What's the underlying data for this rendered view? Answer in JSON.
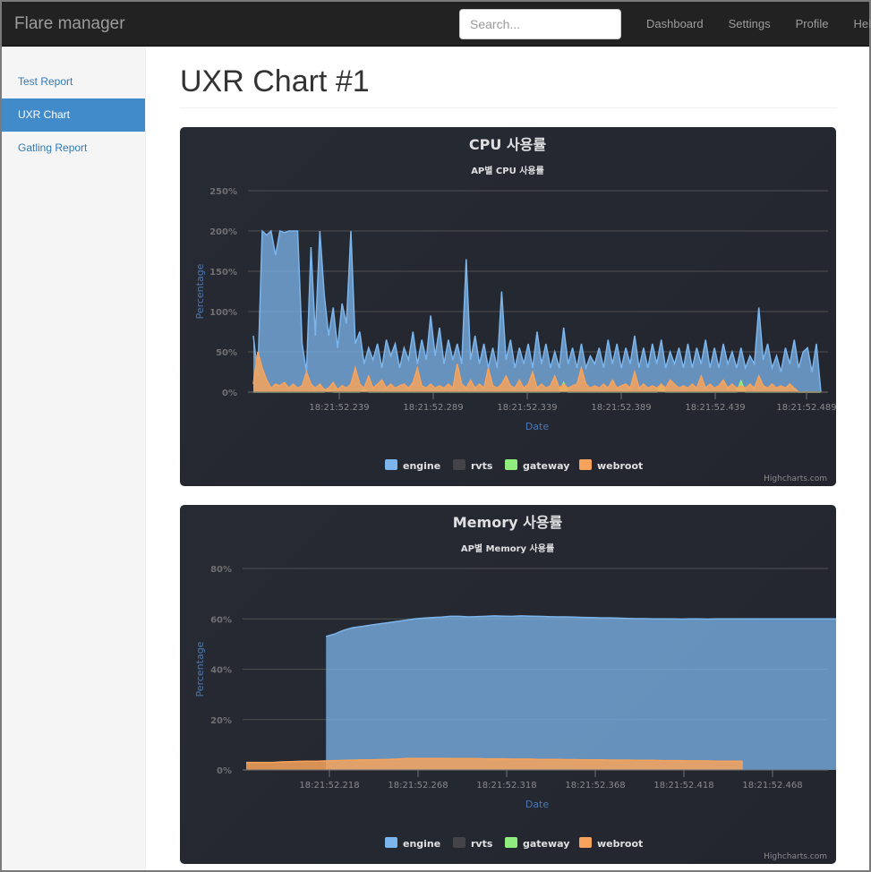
{
  "app": {
    "brand": "Flare manager",
    "search": {
      "placeholder": "Search..."
    },
    "nav": [
      "Dashboard",
      "Settings",
      "Profile",
      "Help"
    ]
  },
  "sidebar": {
    "items": [
      {
        "label": "Test Report",
        "active": false
      },
      {
        "label": "UXR Chart",
        "active": true
      },
      {
        "label": "Gatling Report",
        "active": false
      }
    ]
  },
  "page": {
    "title": "UXR Chart #1"
  },
  "colors": {
    "engine": "#7cb5ec",
    "rvts": "#434348",
    "gateway": "#90ed7d",
    "webroot": "#f7a35c",
    "card_bg": "#24272f",
    "grid": "#505053",
    "active_nav": "#428bca"
  },
  "chart_data": [
    {
      "type": "area",
      "title": "CPU 사용률",
      "subtitle": "AP별 CPU 사용률",
      "xlabel": "Date",
      "ylabel": "Percentage",
      "ylim": [
        0,
        250
      ],
      "yticks": [
        "0%",
        "50%",
        "100%",
        "150%",
        "200%",
        "250%"
      ],
      "xticks": [
        "18:21:52.239",
        "18:21:52.289",
        "18:21:52.339",
        "18:21:52.389",
        "18:21:52.439",
        "18:21:52.489"
      ],
      "grid": true,
      "legend_position": "bottom",
      "legend": [
        "engine",
        "rvts",
        "gateway",
        "webroot"
      ],
      "credits": "Highcharts.com",
      "series": [
        {
          "name": "engine",
          "values": [
            70,
            20,
            200,
            195,
            200,
            170,
            200,
            198,
            200,
            200,
            200,
            60,
            25,
            180,
            70,
            200,
            120,
            70,
            105,
            55,
            110,
            85,
            200,
            60,
            75,
            35,
            55,
            40,
            60,
            30,
            65,
            45,
            60,
            30,
            55,
            40,
            75,
            35,
            65,
            40,
            95,
            45,
            80,
            35,
            65,
            40,
            60,
            35,
            165,
            40,
            70,
            35,
            60,
            30,
            55,
            30,
            125,
            40,
            65,
            30,
            55,
            35,
            60,
            30,
            75,
            35,
            60,
            30,
            50,
            30,
            80,
            35,
            55,
            30,
            60,
            30,
            45,
            35,
            55,
            30,
            65,
            35,
            60,
            30,
            55,
            35,
            70,
            30,
            55,
            30,
            60,
            35,
            65,
            30,
            50,
            35,
            55,
            30,
            60,
            30,
            55,
            35,
            65,
            30,
            55,
            30,
            60,
            35,
            50,
            30,
            55,
            30,
            45,
            35,
            105,
            40,
            60,
            30,
            45,
            25,
            55,
            35,
            65,
            30,
            50,
            55,
            25,
            60,
            0
          ]
        },
        {
          "name": "rvts",
          "values": [
            0,
            0,
            0,
            0,
            0,
            0,
            0,
            0,
            0,
            0,
            0,
            0,
            0,
            0,
            0,
            0,
            0,
            0,
            0,
            0,
            0,
            0,
            0,
            0,
            0,
            0,
            0,
            0,
            0,
            0,
            0,
            0,
            0,
            0,
            0,
            0,
            0,
            0,
            0,
            0,
            0,
            0,
            0,
            0,
            0,
            0,
            0,
            0,
            0,
            0,
            0,
            0,
            0,
            0,
            0,
            0,
            0,
            0,
            0,
            0,
            0,
            0,
            0,
            0,
            0,
            0,
            0,
            0,
            0,
            0,
            0,
            0,
            0,
            0,
            0,
            0,
            0,
            0,
            0,
            0,
            0,
            0,
            0,
            0,
            0,
            0,
            0,
            0,
            0,
            0,
            0,
            0,
            0,
            0,
            0,
            0,
            0,
            0,
            0,
            0,
            0,
            0,
            0,
            0,
            0,
            0,
            0,
            0,
            0,
            0,
            0,
            0,
            0,
            0,
            0,
            0,
            0,
            0,
            0,
            0,
            0,
            0,
            0,
            0,
            0,
            0,
            0,
            0,
            0
          ]
        },
        {
          "name": "gateway",
          "values": [
            0,
            0,
            0,
            0,
            0,
            0,
            0,
            0,
            0,
            0,
            0,
            0,
            0,
            0,
            0,
            0,
            0,
            2,
            0,
            0,
            0,
            0,
            0,
            0,
            0,
            3,
            0,
            0,
            0,
            0,
            0,
            0,
            0,
            0,
            0,
            0,
            0,
            0,
            0,
            0,
            0,
            0,
            0,
            0,
            0,
            0,
            0,
            0,
            0,
            0,
            0,
            0,
            0,
            0,
            0,
            0,
            0,
            0,
            0,
            0,
            0,
            0,
            0,
            0,
            0,
            0,
            0,
            0,
            0,
            0,
            12,
            0,
            0,
            0,
            0,
            0,
            0,
            0,
            0,
            0,
            0,
            0,
            0,
            0,
            0,
            0,
            0,
            0,
            0,
            0,
            0,
            0,
            10,
            0,
            0,
            0,
            0,
            0,
            0,
            0,
            0,
            0,
            0,
            0,
            0,
            0,
            0,
            0,
            0,
            0,
            14,
            0,
            0,
            0,
            0,
            0,
            0,
            0,
            0,
            0,
            0,
            0,
            0,
            0,
            0,
            0,
            0,
            0,
            0
          ]
        },
        {
          "name": "webroot",
          "values": [
            10,
            50,
            30,
            15,
            5,
            10,
            8,
            12,
            5,
            10,
            5,
            8,
            25,
            10,
            5,
            10,
            3,
            5,
            12,
            3,
            8,
            5,
            10,
            30,
            10,
            5,
            20,
            5,
            10,
            15,
            5,
            10,
            5,
            8,
            10,
            5,
            12,
            30,
            8,
            5,
            10,
            5,
            8,
            5,
            10,
            5,
            35,
            10,
            5,
            15,
            5,
            10,
            5,
            30,
            8,
            5,
            10,
            20,
            8,
            5,
            15,
            5,
            10,
            25,
            5,
            10,
            5,
            8,
            20,
            5,
            10,
            5,
            8,
            10,
            30,
            10,
            5,
            8,
            5,
            10,
            5,
            15,
            5,
            8,
            10,
            5,
            25,
            5,
            10,
            5,
            8,
            5,
            10,
            5,
            15,
            10,
            5,
            8,
            5,
            10,
            5,
            20,
            5,
            10,
            5,
            8,
            15,
            5,
            10,
            5,
            8,
            5,
            10,
            5,
            20,
            8,
            5,
            10,
            5,
            8,
            5,
            10,
            5,
            0,
            0,
            0,
            0,
            0,
            0
          ]
        }
      ]
    },
    {
      "type": "area",
      "title": "Memory 사용률",
      "subtitle": "AP별 Memory 사용률",
      "xlabel": "Date",
      "ylabel": "Percentage",
      "ylim": [
        0,
        80
      ],
      "yticks": [
        "0%",
        "20%",
        "40%",
        "60%",
        "80%"
      ],
      "xticks": [
        "18:21:52.218",
        "18:21:52.268",
        "18:21:52.318",
        "18:21:52.368",
        "18:21:52.418",
        "18:21:52.468"
      ],
      "grid": true,
      "legend_position": "bottom",
      "legend": [
        "engine",
        "rvts",
        "gateway",
        "webroot"
      ],
      "credits": "Highcharts.com",
      "series": [
        {
          "name": "engine",
          "start_index": 9,
          "values": [
            53,
            54,
            55.5,
            56.5,
            57,
            57.5,
            58,
            58.5,
            59,
            59.5,
            60,
            60.3,
            60.5,
            60.7,
            61,
            61,
            60.8,
            60.9,
            61,
            61.2,
            61.1,
            61,
            61.2,
            61.1,
            61,
            60.9,
            60.8,
            60.8,
            60.7,
            60.6,
            60.5,
            60.4,
            60.4,
            60.3,
            60.2,
            60.1,
            60.1,
            60,
            60,
            60,
            59.9,
            60,
            60,
            59.9,
            60,
            60,
            60,
            60,
            60,
            60,
            60,
            60,
            60,
            60,
            60,
            60,
            60,
            60,
            60
          ]
        },
        {
          "name": "rvts",
          "start_index": 0,
          "values": []
        },
        {
          "name": "gateway",
          "start_index": 0,
          "values": []
        },
        {
          "name": "webroot",
          "start_index": 0,
          "values": [
            3,
            3,
            3,
            3,
            3.2,
            3.3,
            3.4,
            3.5,
            3.5,
            3.6,
            3.7,
            3.8,
            3.9,
            4,
            4,
            4.1,
            4.2,
            4.3,
            4.5,
            4.6,
            4.6,
            4.6,
            4.6,
            4.5,
            4.5,
            4.5,
            4.5,
            4.4,
            4.4,
            4.4,
            4.3,
            4.3,
            4.3,
            4.2,
            4.2,
            4.2,
            4.1,
            4.1,
            4,
            4,
            4,
            3.9,
            3.9,
            3.9,
            3.8,
            3.8,
            3.8,
            3.7,
            3.7,
            3.7,
            3.6,
            3.6,
            3.6,
            3.5,
            3.5,
            3.5,
            3.5
          ]
        }
      ]
    }
  ]
}
